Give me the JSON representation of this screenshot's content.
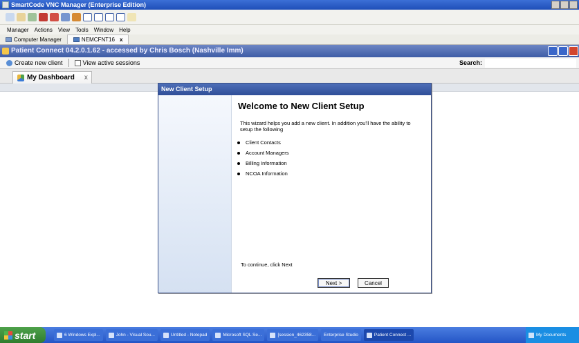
{
  "vnc": {
    "title": "SmartCode VNC Manager (Enterprise Edition)",
    "menu": [
      "Manager",
      "Actions",
      "View",
      "Tools",
      "Window",
      "Help"
    ],
    "tabs": [
      {
        "label": "Computer Manager"
      },
      {
        "label": "NEMCFNT16",
        "close": "x"
      }
    ]
  },
  "app": {
    "title": "Patient Connect 04.2.0.1.62 - accessed by Chris Bosch (Nashville Imm)",
    "toolbar": {
      "create_client": "Create new client",
      "view_sessions": "View active sessions",
      "search_label": "Search:",
      "search_value": ""
    },
    "dashboard_tab": {
      "label": "My Dashboard",
      "close": "x"
    }
  },
  "wizard": {
    "title": "New Client Setup",
    "heading": "Welcome to New Client Setup",
    "intro": "This wizard helps you add a new client. In addition you'll have the ability to setup the following",
    "items": [
      "Client Contacts",
      "Account Managers",
      "Billing Information",
      "NCOA Information"
    ],
    "continue_text": "To continue, click Next",
    "next_label": "Next >",
    "cancel_label": "Cancel"
  },
  "taskbar": {
    "start_label": "start",
    "tasks": [
      "6 Windows Expl...",
      "John - Visual Sou...",
      "Untitled - Notepad",
      "Microsoft SQL Se...",
      "[session_462358...",
      "Enterprise Studio",
      "Patient Connect ..."
    ],
    "tray_label": "My Documents"
  },
  "colors": {
    "vnc_title": "#1f4fb8",
    "app_title": "#3e5ca6",
    "wizard_title": "#2f4e98",
    "taskbar": "#2455c6",
    "start_button": "#2f7d2e"
  }
}
